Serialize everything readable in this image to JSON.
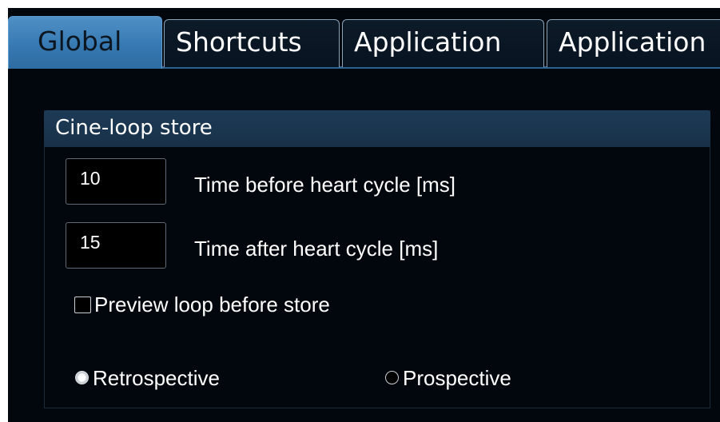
{
  "tabs": [
    {
      "label": "Global",
      "active": true
    },
    {
      "label": "Shortcuts",
      "active": false
    },
    {
      "label": "Application",
      "active": false
    },
    {
      "label": "Application",
      "active": false
    }
  ],
  "cine_loop": {
    "title": "Cine-loop store",
    "time_before": {
      "value": "10",
      "label": "Time before heart cycle [ms]"
    },
    "time_after": {
      "value": "15",
      "label": "Time after heart cycle [ms]"
    },
    "preview": {
      "label": "Preview loop before store",
      "checked": false
    },
    "mode": {
      "options": [
        {
          "label": "Retrospective",
          "selected": true
        },
        {
          "label": "Prospective",
          "selected": false
        }
      ]
    }
  },
  "colors": {
    "active_tab": "#3779b2",
    "group_header": "#1d3a56",
    "background": "#02070d"
  }
}
